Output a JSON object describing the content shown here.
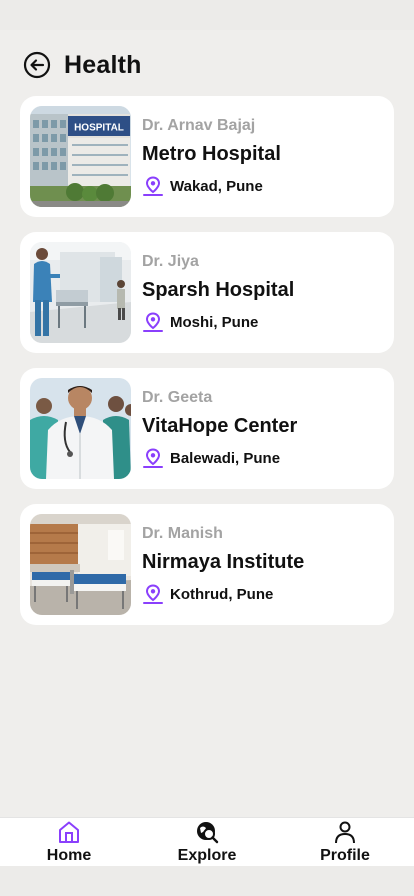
{
  "header": {
    "title": "Health"
  },
  "colors": {
    "accent": "#8a3ffc",
    "background": "#efeeec",
    "card": "#ffffff",
    "muted": "#a3a3a3"
  },
  "hospitals": [
    {
      "doctor": "Dr. Arnav Bajaj",
      "name": "Metro Hospital",
      "location": "Wakad, Pune"
    },
    {
      "doctor": "Dr. Jiya",
      "name": "Sparsh Hospital",
      "location": "Moshi, Pune"
    },
    {
      "doctor": "Dr. Geeta",
      "name": "VitaHope Center",
      "location": "Balewadi, Pune"
    },
    {
      "doctor": "Dr. Manish",
      "name": "Nirmaya Institute",
      "location": "Kothrud, Pune"
    }
  ],
  "photo_sign": "HOSPITAL",
  "tabs": [
    {
      "label": "Home",
      "icon": "home-icon",
      "active": true
    },
    {
      "label": "Explore",
      "icon": "explore-icon",
      "active": false
    },
    {
      "label": "Profile",
      "icon": "profile-icon",
      "active": false
    }
  ]
}
